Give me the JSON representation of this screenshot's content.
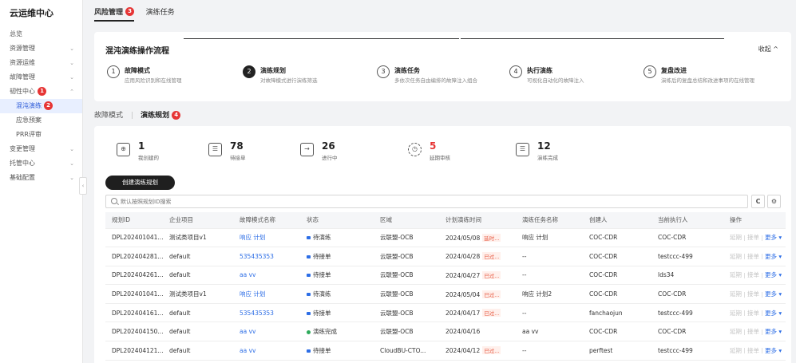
{
  "sidebar": {
    "brand": "云运维中心",
    "items": [
      {
        "label": "总览",
        "chev": ""
      },
      {
        "label": "资源管理",
        "chev": "⌄"
      },
      {
        "label": "资源运维",
        "chev": "⌄"
      },
      {
        "label": "故障管理",
        "chev": "⌄"
      },
      {
        "label": "韧性中心",
        "chev": "⌃",
        "badge": "1"
      },
      {
        "label": "混沌演练",
        "badge": "2",
        "active": true
      },
      {
        "label": "应急预案"
      },
      {
        "label": "PRR评审"
      },
      {
        "label": "变更管理",
        "chev": "⌄"
      },
      {
        "label": "托管中心",
        "chev": "⌄"
      },
      {
        "label": "基础配置",
        "chev": "⌄"
      }
    ],
    "collapse_glyph": "‹"
  },
  "top_tabs": [
    {
      "label": "风险管理",
      "badge": "3",
      "active": true
    },
    {
      "label": "演练任务"
    }
  ],
  "flow": {
    "title": "混沌演练操作流程",
    "collapse_label": "收起 ^",
    "steps": [
      {
        "num": "1",
        "title": "故障模式",
        "desc": "应用风险识别和在线管理"
      },
      {
        "num": "2",
        "title": "演练规划",
        "desc": "对故障模式进行演练筛选"
      },
      {
        "num": "3",
        "title": "演练任务",
        "desc": "多依次任务自由编排的故障注入组合"
      },
      {
        "num": "4",
        "title": "执行演练",
        "desc": "可视化自动化的故障注入"
      },
      {
        "num": "5",
        "title": "复盘改进",
        "desc": "演练后的复盘总结和改进事项的在线管理"
      }
    ]
  },
  "section_tabs": [
    {
      "label": "故障模式"
    },
    {
      "label": "演练规划",
      "badge": "4",
      "active": true
    }
  ],
  "stats": [
    {
      "num": "1",
      "label": "我创建的",
      "icon": "user-plus-icon",
      "glyph": "⊕"
    },
    {
      "num": "78",
      "label": "待接单",
      "icon": "inbox-icon",
      "glyph": "☰"
    },
    {
      "num": "26",
      "label": "进行中",
      "icon": "arrow-right-icon",
      "glyph": "→"
    },
    {
      "num": "5",
      "label": "延期审核",
      "icon": "clock-icon",
      "glyph": "◷",
      "red": true
    },
    {
      "num": "12",
      "label": "演练完成",
      "icon": "check-list-icon",
      "glyph": "☰"
    }
  ],
  "toolbar": {
    "create_label": "创建演练规划",
    "search_placeholder": "默认按照规划ID搜索",
    "refresh_glyph": "C",
    "settings_glyph": "⚙"
  },
  "table": {
    "columns": [
      "规划ID",
      "企业项目",
      "故障模式名称",
      "状态",
      "区域",
      "计划演练时间",
      "演练任务名称",
      "创建人",
      "当前执行人",
      "操作"
    ],
    "rows": [
      {
        "id": "DPL202401041...",
        "project": "测试类项目v1",
        "mode": "响应 计划",
        "status": "待演练",
        "done": false,
        "region": "云联盟-OCB",
        "time": "2024/05/08",
        "tag": "延时...",
        "task": "响应 计划",
        "creator": "COC-CDR",
        "executor": "COC-CDR"
      },
      {
        "id": "DPL202404281...",
        "project": "default",
        "mode": "535435353",
        "status": "待接单",
        "done": false,
        "region": "云联盟-OCB",
        "time": "2024/04/28",
        "tag": "已过...",
        "task": "--",
        "creator": "COC-CDR",
        "executor": "testccc-499"
      },
      {
        "id": "DPL202404261...",
        "project": "default",
        "mode": "aa vv",
        "status": "待接单",
        "done": false,
        "region": "云联盟-OCB",
        "time": "2024/04/27",
        "tag": "已过...",
        "task": "--",
        "creator": "COC-CDR",
        "executor": "lds34"
      },
      {
        "id": "DPL202401041...",
        "project": "测试类项目v1",
        "mode": "响应 计划",
        "status": "待演练",
        "done": false,
        "region": "云联盟-OCB",
        "time": "2024/05/04",
        "tag": "已过...",
        "task": "响应 计划2",
        "creator": "COC-CDR",
        "executor": "COC-CDR"
      },
      {
        "id": "DPL202404161...",
        "project": "default",
        "mode": "535435353",
        "status": "待接单",
        "done": false,
        "region": "云联盟-OCB",
        "time": "2024/04/17",
        "tag": "已过...",
        "task": "--",
        "creator": "fanchaojun",
        "executor": "testccc-499"
      },
      {
        "id": "DPL202404150...",
        "project": "default",
        "mode": "aa vv",
        "status": "演练完成",
        "done": true,
        "region": "云联盟-OCB",
        "time": "2024/04/16",
        "tag": "",
        "task": "aa vv",
        "creator": "COC-CDR",
        "executor": "COC-CDR"
      },
      {
        "id": "DPL202404121...",
        "project": "default",
        "mode": "aa vv",
        "status": "待接单",
        "done": false,
        "region": "CloudBU-CTO...",
        "time": "2024/04/12",
        "tag": "已过...",
        "task": "--",
        "creator": "perftest",
        "executor": "testccc-499"
      }
    ],
    "ops": {
      "delay": "延期",
      "accept": "接单",
      "more": "更多 ▾"
    }
  }
}
